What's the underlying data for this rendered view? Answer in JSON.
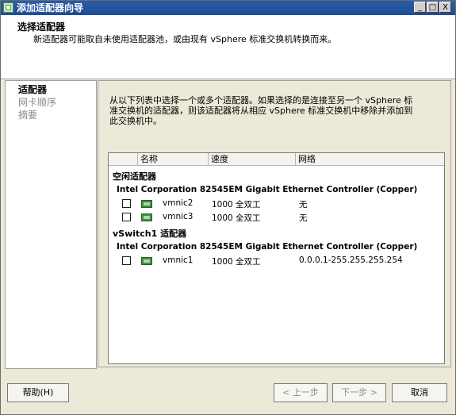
{
  "window": {
    "title": "添加适配器向导",
    "controls": {
      "minimize": "_",
      "maximize": "□",
      "close": "X"
    }
  },
  "header": {
    "title": "选择适配器",
    "description": "新适配器可能取自未使用适配器池，或由现有 vSphere 标准交换机转换而来。"
  },
  "nav": {
    "items": [
      {
        "label": "适配器",
        "state": "active"
      },
      {
        "label": "网卡顺序",
        "state": "disabled"
      },
      {
        "label": "摘要",
        "state": "disabled"
      }
    ]
  },
  "content": {
    "instruction_line1": "从以下列表中选择一个或多个适配器。如果选择的是连接至另一个 vSphere 标",
    "instruction_line2": "准交换机的适配器，则该适配器将从相应 vSphere 标准交换机中移除并添加到",
    "instruction_line3": "此交换机中。",
    "columns": [
      "名称",
      "速度",
      "网络"
    ],
    "groups": [
      {
        "title": "空闲适配器",
        "device": "Intel Corporation 82545EM Gigabit Ethernet Controller (Copper)",
        "rows": [
          {
            "name": "vmnic2",
            "speed": "1000 全双工",
            "network": "无"
          },
          {
            "name": "vmnic3",
            "speed": "1000 全双工",
            "network": "无"
          }
        ]
      },
      {
        "title": "vSwitch1 适配器",
        "device": "Intel Corporation 82545EM Gigabit Ethernet Controller (Copper)",
        "rows": [
          {
            "name": "vmnic1",
            "speed": "1000 全双工",
            "network": "0.0.0.1-255.255.255.254"
          }
        ]
      }
    ]
  },
  "buttons": {
    "help": "帮助(H)",
    "back": "< 上一步",
    "next": "下一步 >",
    "cancel": "取消"
  }
}
